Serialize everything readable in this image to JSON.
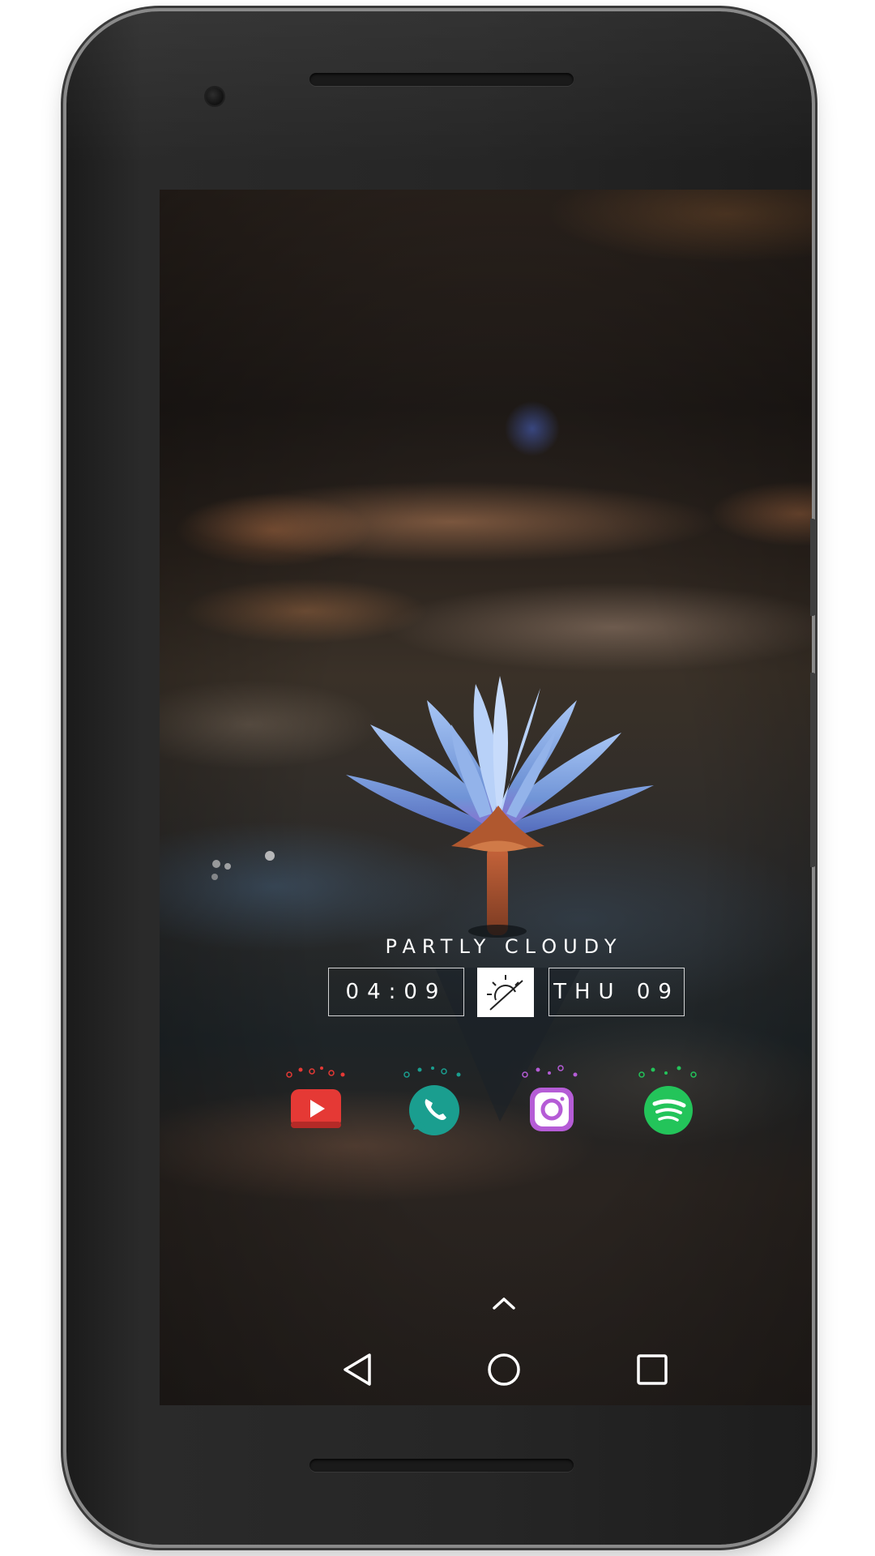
{
  "weather": {
    "condition": "PARTLY CLOUDY",
    "icon": "partly-cloudy-sun-icon"
  },
  "clock": {
    "time": "04:09",
    "date": "THU 09"
  },
  "dock": {
    "apps": [
      {
        "name": "YouTube",
        "icon": "youtube-icon",
        "color": "#e53935"
      },
      {
        "name": "WhatsApp",
        "icon": "whatsapp-icon",
        "color": "#1a9e8f"
      },
      {
        "name": "Instagram",
        "icon": "instagram-icon",
        "color": "#b55cd6"
      },
      {
        "name": "Spotify",
        "icon": "spotify-icon",
        "color": "#23c45a"
      }
    ]
  },
  "app_drawer": {
    "icon": "chevron-up-icon"
  },
  "navigation": {
    "back": "back-triangle-icon",
    "home": "home-circle-icon",
    "recents": "recents-square-icon"
  },
  "colors": {
    "bezel": "#262626",
    "lotus_petal": "#8fb4ec",
    "text": "#ffffff"
  }
}
